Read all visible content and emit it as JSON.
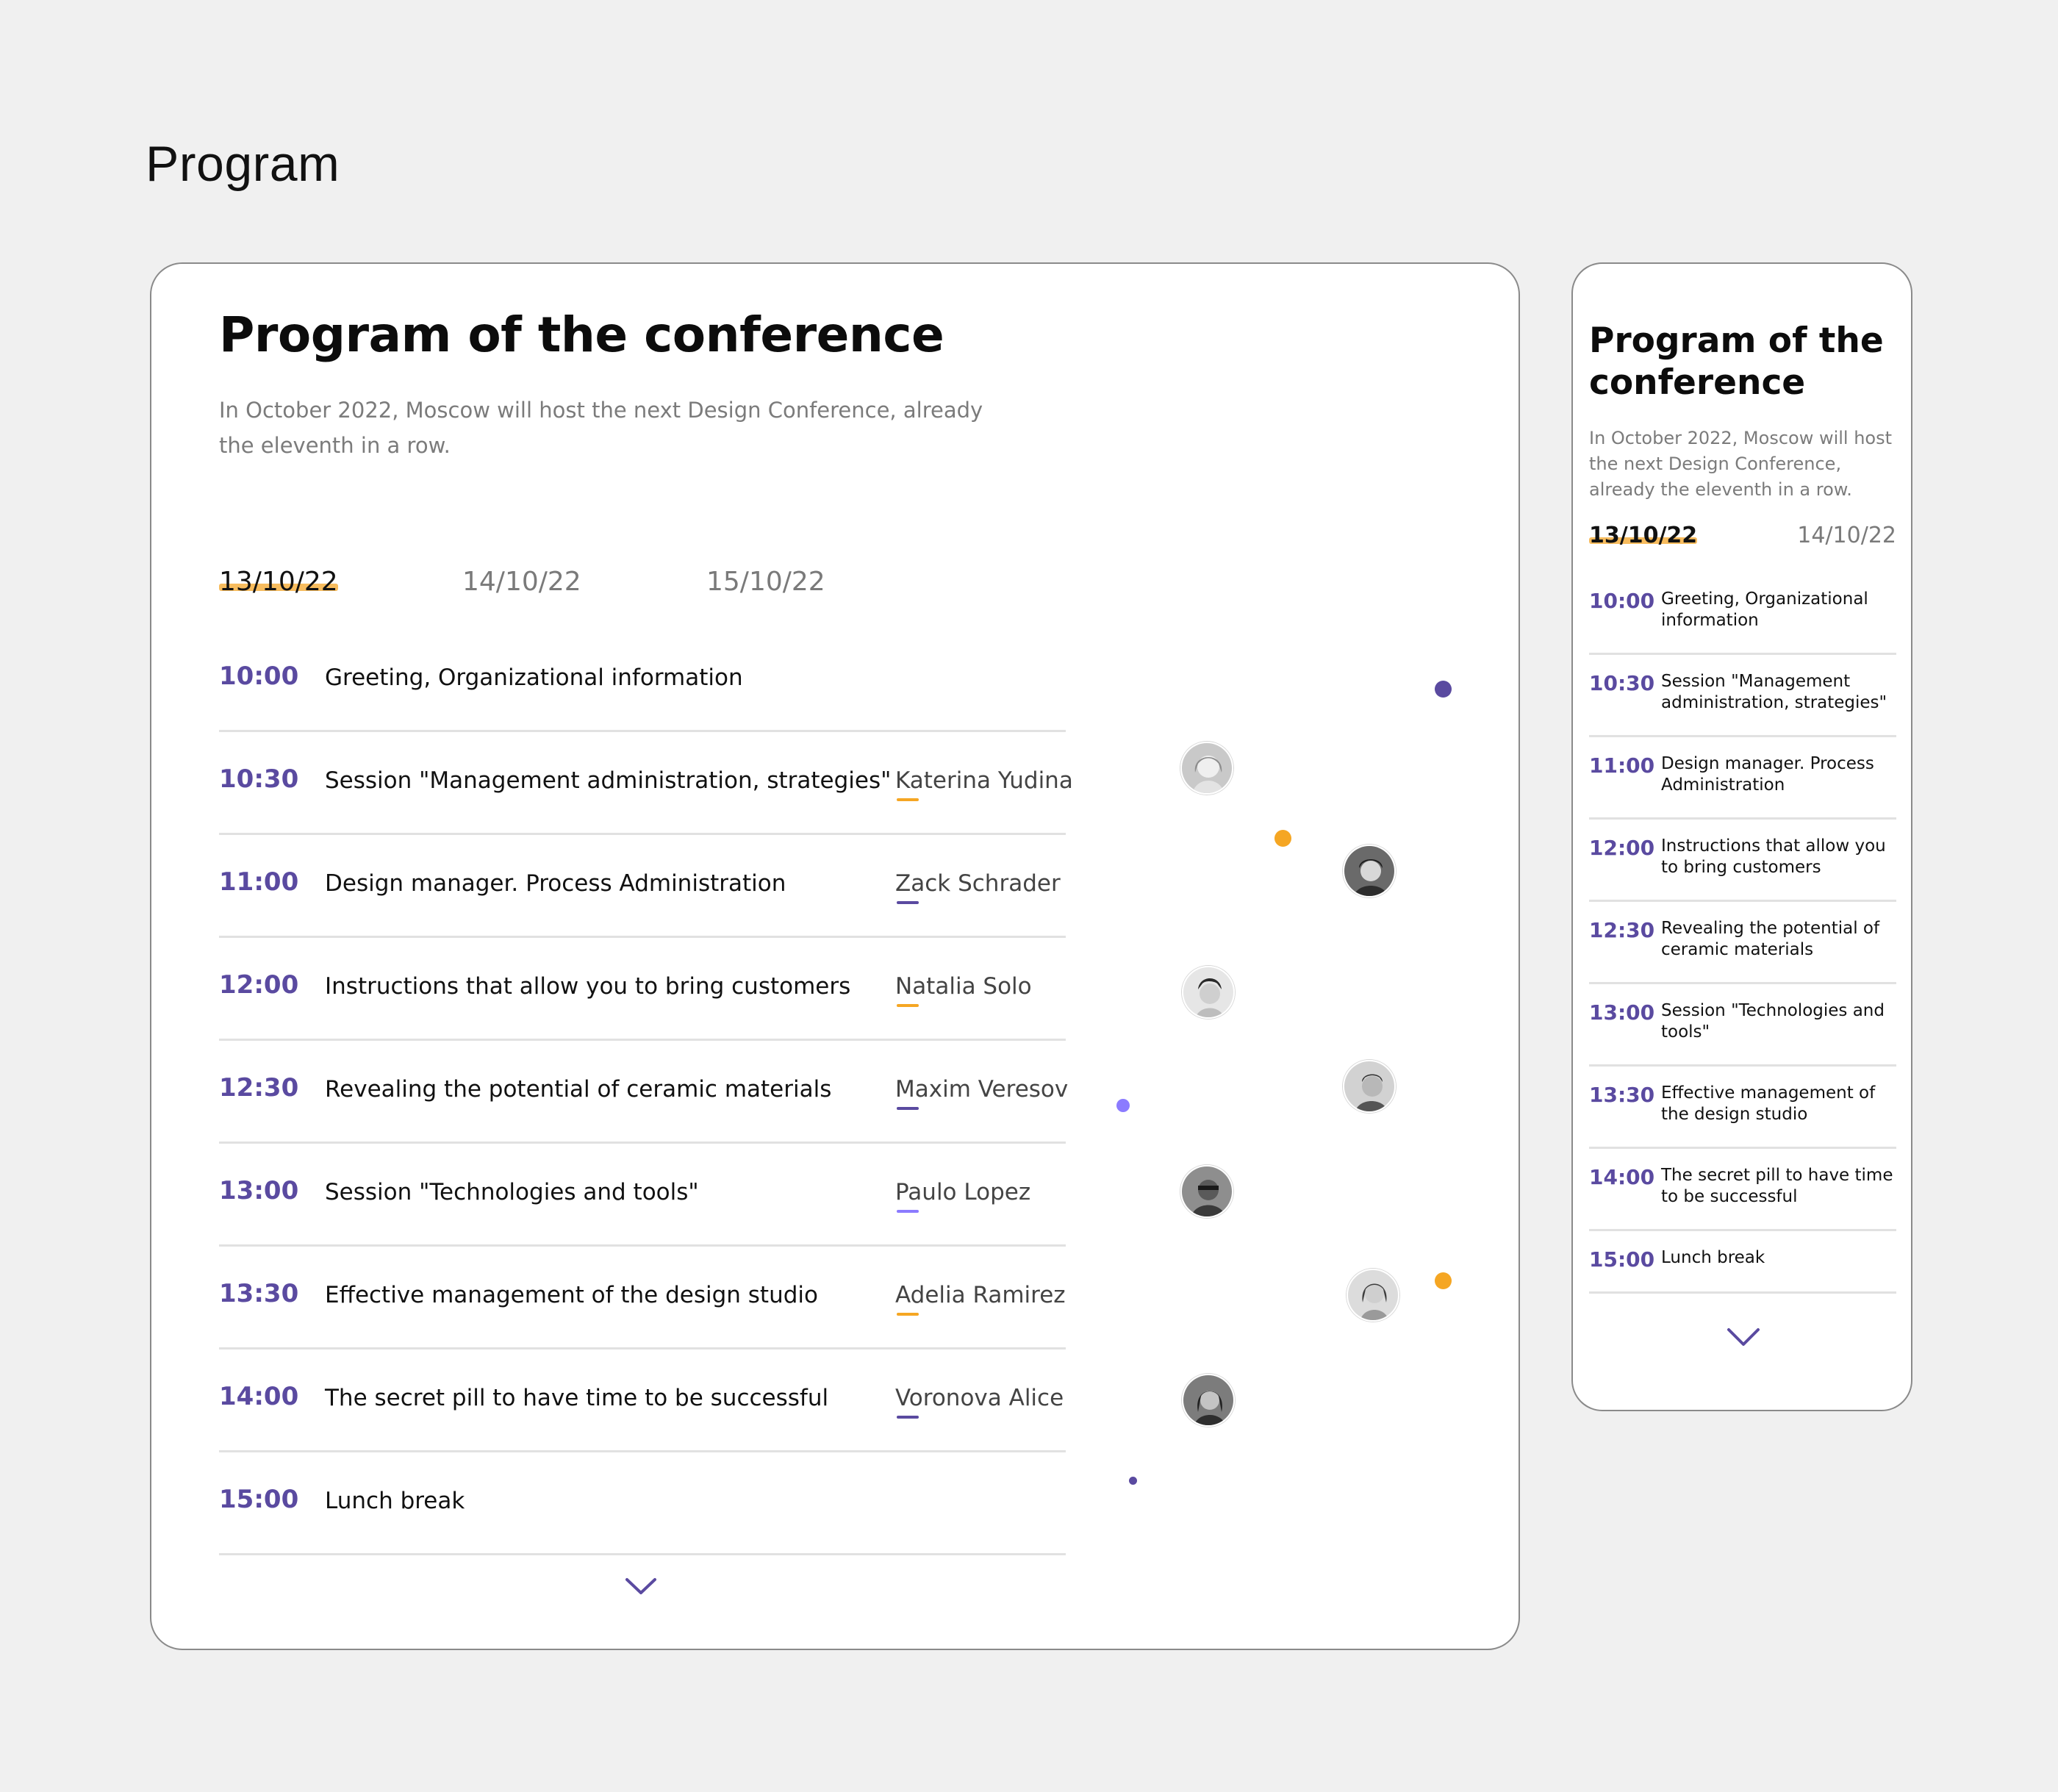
{
  "page": {
    "heading": "Program"
  },
  "desktop": {
    "title": "Program of the conference",
    "description": "In October 2022, Moscow will host the next Design Conference, already the eleventh in a row.",
    "tabs": [
      {
        "label": "13/10/22",
        "active": true
      },
      {
        "label": "14/10/22",
        "active": false
      },
      {
        "label": "15/10/22",
        "active": false
      }
    ],
    "rows": [
      {
        "time": "10:00",
        "topic": "Greeting, Organizational information",
        "speaker": ""
      },
      {
        "time": "10:30",
        "topic": "Session \"Management administration, strategies\"",
        "speaker": "Katerina Yudina",
        "mark_color": "#f5a623"
      },
      {
        "time": "11:00",
        "topic": "Design manager. Process Administration",
        "speaker": "Zack Schrader",
        "mark_color": "#5a4aa0"
      },
      {
        "time": "12:00",
        "topic": "Instructions that allow you to bring customers",
        "speaker": "Natalia Solo",
        "mark_color": "#f5a623"
      },
      {
        "time": "12:30",
        "topic": "Revealing the potential of ceramic materials",
        "speaker": "Maxim Veresov",
        "mark_color": "#5a4aa0"
      },
      {
        "time": "13:00",
        "topic": "Session \"Technologies and tools\"",
        "speaker": "Paulo Lopez",
        "mark_color": "#8b7bff"
      },
      {
        "time": "13:30",
        "topic": "Effective management of the design studio",
        "speaker": "Adelia Ramirez",
        "mark_color": "#f5a623"
      },
      {
        "time": "14:00",
        "topic": "The secret pill to have time to be successful",
        "speaker": "Voronova Alice",
        "mark_color": "#5a4aa0"
      },
      {
        "time": "15:00",
        "topic": "Lunch break",
        "speaker": ""
      }
    ],
    "more_icon": "chevron-down-icon"
  },
  "mobile": {
    "title": "Program of the conference",
    "description": "In October 2022, Moscow will host the next Design Conference, already the eleventh in a row.",
    "tabs": [
      {
        "label": "13/10/22",
        "active": true
      },
      {
        "label": "14/10/22",
        "active": false
      }
    ],
    "rows": [
      {
        "time": "10:00",
        "topic": "Greeting, Organizational information"
      },
      {
        "time": "10:30",
        "topic": "Session \"Management administration, strategies\""
      },
      {
        "time": "11:00",
        "topic": "Design manager. Process Administration"
      },
      {
        "time": "12:00",
        "topic": "Instructions that allow you to bring customers"
      },
      {
        "time": "12:30",
        "topic": "Revealing the potential of ceramic materials"
      },
      {
        "time": "13:00",
        "topic": "Session \"Technologies and tools\""
      },
      {
        "time": "13:30",
        "topic": "Effective management of the design studio"
      },
      {
        "time": "14:00",
        "topic": "The secret pill to have time to be successful"
      },
      {
        "time": "15:00",
        "topic": "Lunch break"
      }
    ],
    "more_icon": "chevron-down-icon"
  },
  "colors": {
    "accent_purple": "#5a4aa0",
    "accent_orange": "#f5a623",
    "accent_light_purple": "#8b7bff",
    "tab_highlight": "#f6b54c"
  }
}
